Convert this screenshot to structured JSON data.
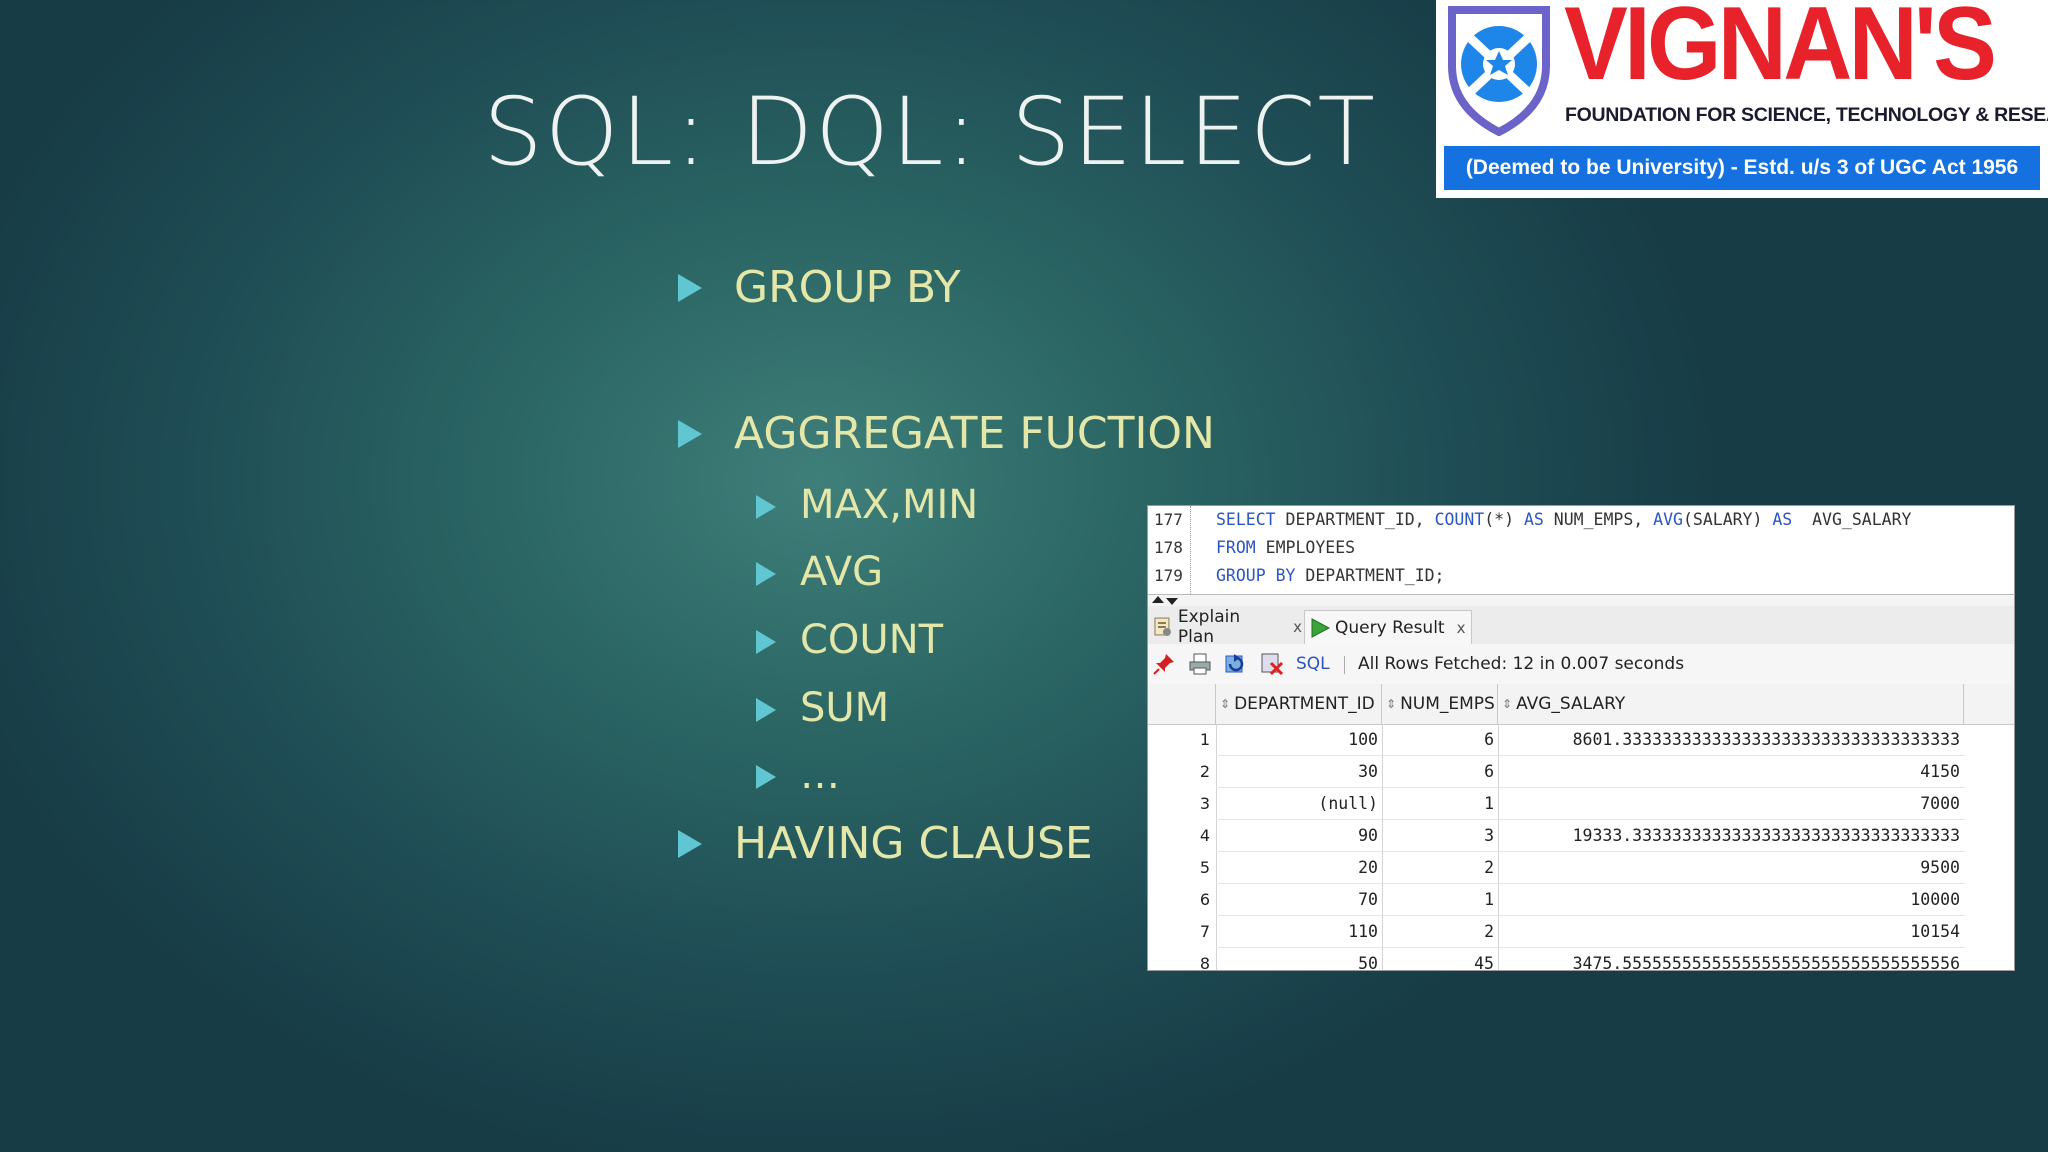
{
  "slide": {
    "title": "SQL: DQL: SELECT",
    "bullets": {
      "group_by": "GROUP BY",
      "aggregate": "AGGREGATE FUCTION",
      "max_min": "MAX,MIN",
      "avg": "AVG",
      "count": "COUNT",
      "sum": "SUM",
      "more": "…",
      "having": "HAVING CLAUSE"
    },
    "colors": {
      "background": "#2b6664",
      "bullet_text": "#e4e7a8",
      "bullet_marker": "#5fc6d2"
    }
  },
  "logo": {
    "brand": "VIGNAN'S",
    "tagline": "FOUNDATION FOR SCIENCE, TECHNOLOGY & RESEARCH",
    "band": "(Deemed to be University) - Estd. u/s 3 of UGC Act 1956",
    "colors": {
      "brand": "#e8222a",
      "band": "#1570e0",
      "shield": "#6b63c8"
    }
  },
  "ide": {
    "editor": {
      "line_numbers": [
        "177",
        "178",
        "179"
      ],
      "line1": {
        "kw1": "SELECT",
        "t1": " DEPARTMENT_ID, ",
        "kw2": "COUNT",
        "t2": "(*) ",
        "kw3": "AS",
        "t3": " NUM_EMPS, ",
        "kw4": "AVG",
        "t4": "(SALARY) ",
        "kw5": "AS",
        "t5": "  AVG_SALARY"
      },
      "line2": {
        "kw1": "FROM",
        "t1": " EMPLOYEES"
      },
      "line3": {
        "kw1": "GROUP BY",
        "t1": " DEPARTMENT_ID;"
      }
    },
    "tabs": {
      "explain_plan": "Explain Plan",
      "query_result": "Query Result",
      "close": "x"
    },
    "toolbar": {
      "sql_link": "SQL",
      "status": "All Rows Fetched: 12 in 0.007 seconds"
    },
    "grid": {
      "columns": [
        "DEPARTMENT_ID",
        "NUM_EMPS",
        "AVG_SALARY"
      ],
      "rows": [
        {
          "n": "1",
          "dept": "100",
          "emps": "6",
          "avg": "8601.3333333333333333333333333333333333"
        },
        {
          "n": "2",
          "dept": "30",
          "emps": "6",
          "avg": "4150"
        },
        {
          "n": "3",
          "dept": "(null)",
          "emps": "1",
          "avg": "7000"
        },
        {
          "n": "4",
          "dept": "90",
          "emps": "3",
          "avg": "19333.333333333333333333333333333333333"
        },
        {
          "n": "5",
          "dept": "20",
          "emps": "2",
          "avg": "9500"
        },
        {
          "n": "6",
          "dept": "70",
          "emps": "1",
          "avg": "10000"
        },
        {
          "n": "7",
          "dept": "110",
          "emps": "2",
          "avg": "10154"
        },
        {
          "n": "8",
          "dept": "50",
          "emps": "45",
          "avg": "3475.5555555555555555555555555555555556"
        }
      ]
    }
  }
}
